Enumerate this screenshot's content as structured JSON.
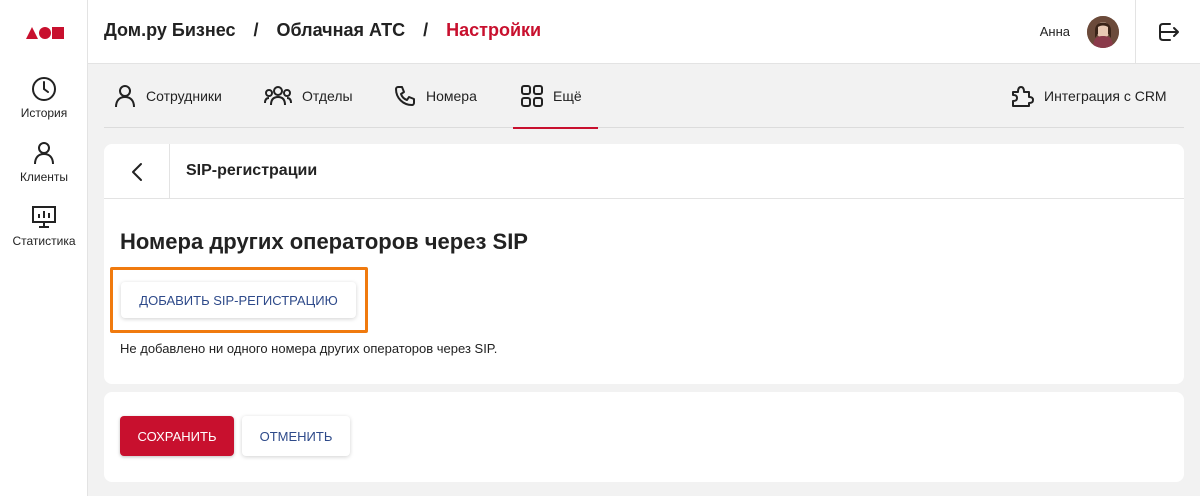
{
  "header": {
    "breadcrumbs": [
      "Дом.ру Бизнес",
      "Облачная АТС",
      "Настройки"
    ],
    "separator": "/",
    "user_name": "Анна"
  },
  "sidebar": {
    "items": [
      {
        "label": "История",
        "icon": "clock-icon"
      },
      {
        "label": "Клиенты",
        "icon": "person-icon"
      },
      {
        "label": "Статистика",
        "icon": "chart-monitor-icon"
      }
    ]
  },
  "tabs": [
    {
      "label": "Сотрудники",
      "icon": "person-icon"
    },
    {
      "label": "Отделы",
      "icon": "group-icon"
    },
    {
      "label": "Номера",
      "icon": "phone-icon"
    },
    {
      "label": "Ещё",
      "icon": "grid-icon",
      "active": true
    },
    {
      "label": "Интеграция с CRM",
      "icon": "puzzle-icon"
    }
  ],
  "card": {
    "title": "SIP-регистрации",
    "section_title": "Номера других операторов через SIP",
    "add_button": "ДОБАВИТЬ SIP-РЕГИСТРАЦИЮ",
    "empty_text": "Не добавлено ни одного номера других операторов через SIP."
  },
  "actions": {
    "save": "СОХРАНИТЬ",
    "cancel": "ОТМЕНИТЬ"
  },
  "colors": {
    "accent": "#c8102e",
    "link": "#2e4a8a",
    "highlight": "#f07a0e"
  }
}
